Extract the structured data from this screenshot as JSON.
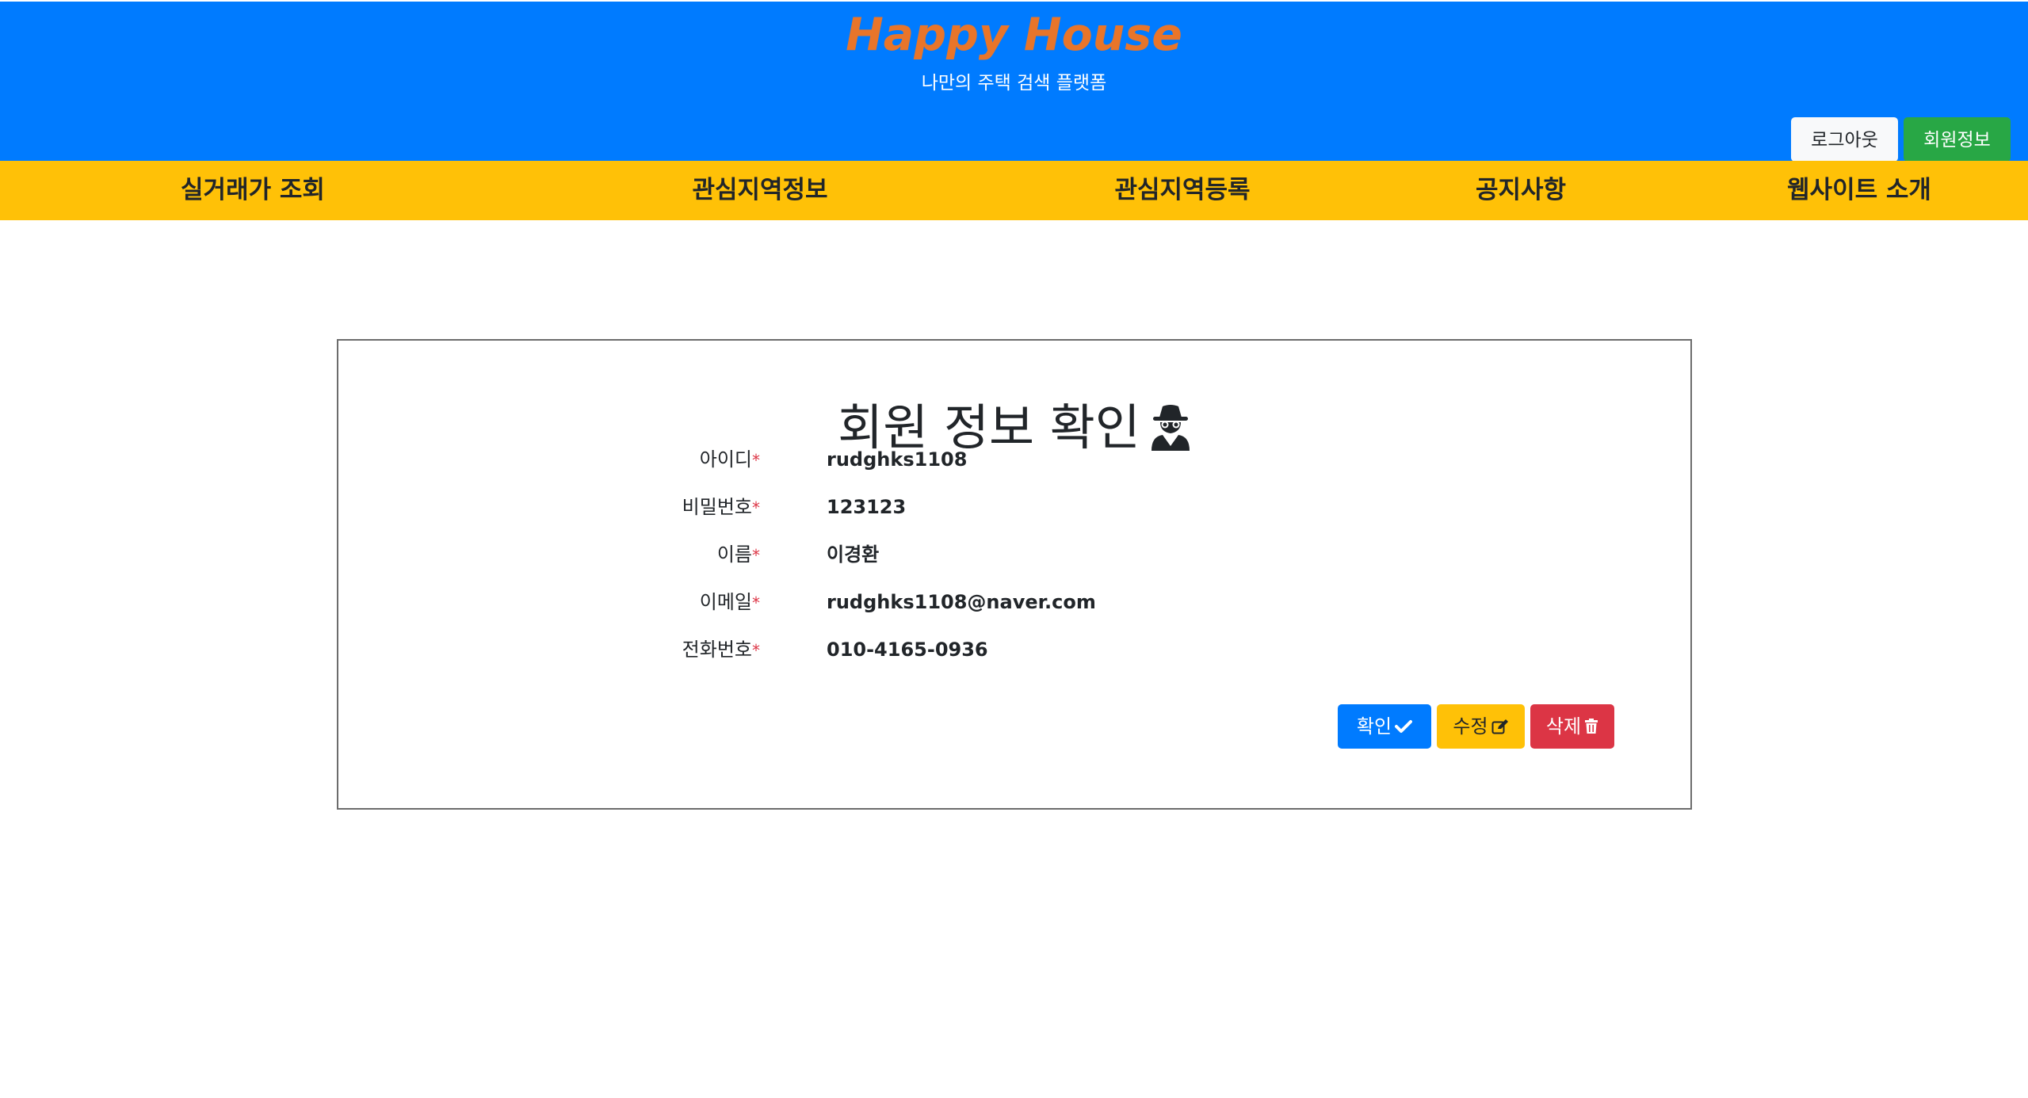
{
  "header": {
    "title": "Happy House",
    "subtitle": "나만의 주택 검색 플랫폼",
    "logout_label": "로그아웃",
    "member_info_label": "회원정보"
  },
  "nav": {
    "items": [
      {
        "label": "실거래가 조회"
      },
      {
        "label": "관심지역정보"
      },
      {
        "label": "관심지역등록"
      },
      {
        "label": "공지사항"
      },
      {
        "label": "웹사이트 소개"
      }
    ]
  },
  "member": {
    "title": "회원 정보 확인",
    "title_icon": "user-secret-icon",
    "fields": [
      {
        "label": "아이디",
        "required": "*",
        "value": "rudghks1108"
      },
      {
        "label": "비밀번호",
        "required": "*",
        "value": "123123"
      },
      {
        "label": "이름",
        "required": "*",
        "value": "이경환"
      },
      {
        "label": "이메일",
        "required": "*",
        "value": "rudghks1108@naver.com"
      },
      {
        "label": "전화번호",
        "required": "*",
        "value": "010-4165-0936"
      }
    ],
    "buttons": {
      "confirm_label": "확인",
      "confirm_icon": "check-icon",
      "edit_label": "수정",
      "edit_icon": "edit-icon",
      "delete_label": "삭제",
      "delete_icon": "trash-icon"
    }
  },
  "colors": {
    "header_bg": "#007bff",
    "brand_title": "#e8752a",
    "nav_bg": "#ffc107",
    "success": "#28a745",
    "danger": "#dc3545",
    "primary": "#007bff",
    "warning": "#ffc107"
  }
}
